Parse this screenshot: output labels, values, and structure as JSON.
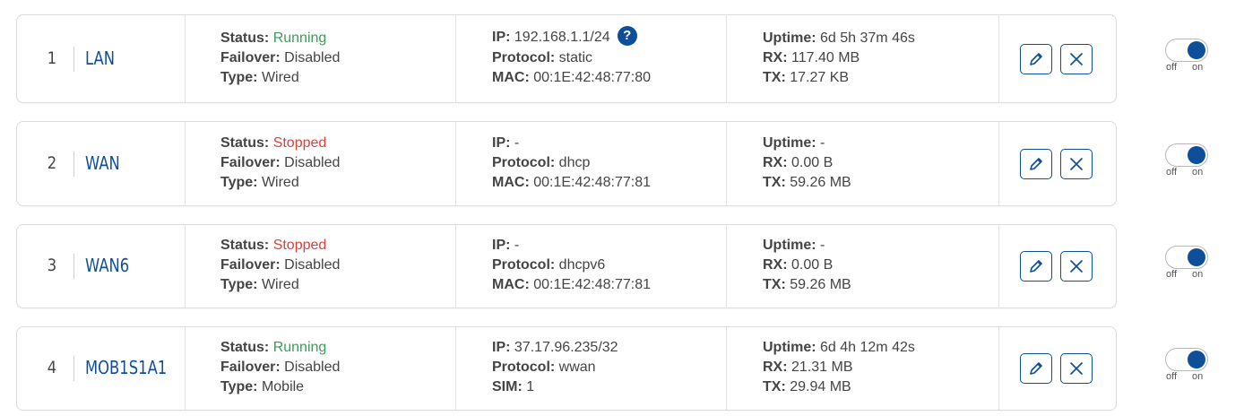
{
  "labels": {
    "status": "Status:",
    "failover": "Failover:",
    "type": "Type:",
    "ip": "IP:",
    "protocol": "Protocol:",
    "mac": "MAC:",
    "sim": "SIM:",
    "uptime": "Uptime:",
    "rx": "RX:",
    "tx": "TX:",
    "toggle_off": "off",
    "toggle_on": "on",
    "help_glyph": "?"
  },
  "colors": {
    "accent": "#0e4f9a",
    "running": "#3d9a5a",
    "stopped": "#d9413a"
  },
  "interfaces": [
    {
      "index": "1",
      "name": "LAN",
      "status": "Running",
      "status_state": "ok",
      "failover": "Disabled",
      "type": "Wired",
      "ip": "192.168.1.1/24",
      "has_help": true,
      "protocol": "static",
      "third_label": "mac",
      "third_value": "00:1E:42:48:77:80",
      "uptime": "6d 5h 37m 46s",
      "rx": "117.40 MB",
      "tx": "17.27 KB",
      "enabled": true
    },
    {
      "index": "2",
      "name": "WAN",
      "status": "Stopped",
      "status_state": "bad",
      "failover": "Disabled",
      "type": "Wired",
      "ip": "-",
      "has_help": false,
      "protocol": "dhcp",
      "third_label": "mac",
      "third_value": "00:1E:42:48:77:81",
      "uptime": "-",
      "rx": "0.00 B",
      "tx": "59.26 MB",
      "enabled": true
    },
    {
      "index": "3",
      "name": "WAN6",
      "status": "Stopped",
      "status_state": "bad",
      "failover": "Disabled",
      "type": "Wired",
      "ip": "-",
      "has_help": false,
      "protocol": "dhcpv6",
      "third_label": "mac",
      "third_value": "00:1E:42:48:77:81",
      "uptime": "-",
      "rx": "0.00 B",
      "tx": "59.26 MB",
      "enabled": true
    },
    {
      "index": "4",
      "name": "MOB1S1A1",
      "status": "Running",
      "status_state": "ok",
      "failover": "Disabled",
      "type": "Mobile",
      "ip": "37.17.96.235/32",
      "has_help": false,
      "protocol": "wwan",
      "third_label": "sim",
      "third_value": "1",
      "uptime": "6d 4h 12m 42s",
      "rx": "21.31 MB",
      "tx": "29.94 MB",
      "enabled": true
    }
  ]
}
